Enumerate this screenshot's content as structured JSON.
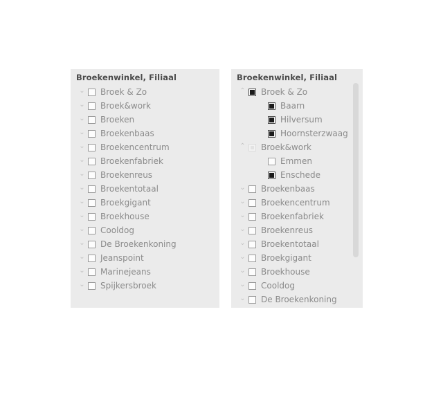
{
  "panels": {
    "collapsed": {
      "header": "Broekenwinkel, Filiaal",
      "nodes": [
        {
          "label": "Broek & Zo",
          "level": 0,
          "chevron": "v",
          "check": "unchecked"
        },
        {
          "label": "Broek&work",
          "level": 0,
          "chevron": "v",
          "check": "unchecked"
        },
        {
          "label": "Broeken",
          "level": 0,
          "chevron": "v",
          "check": "unchecked"
        },
        {
          "label": "Broekenbaas",
          "level": 0,
          "chevron": "v",
          "check": "unchecked"
        },
        {
          "label": "Broekencentrum",
          "level": 0,
          "chevron": "v",
          "check": "unchecked"
        },
        {
          "label": "Broekenfabriek",
          "level": 0,
          "chevron": "v",
          "check": "unchecked"
        },
        {
          "label": "Broekenreus",
          "level": 0,
          "chevron": "v",
          "check": "unchecked"
        },
        {
          "label": "Broekentotaal",
          "level": 0,
          "chevron": "v",
          "check": "unchecked"
        },
        {
          "label": "Broekgigant",
          "level": 0,
          "chevron": "v",
          "check": "unchecked"
        },
        {
          "label": "Broekhouse",
          "level": 0,
          "chevron": "v",
          "check": "unchecked"
        },
        {
          "label": "Cooldog",
          "level": 0,
          "chevron": "v",
          "check": "unchecked"
        },
        {
          "label": "De Broekenkoning",
          "level": 0,
          "chevron": "v",
          "check": "unchecked"
        },
        {
          "label": "Jeanspoint",
          "level": 0,
          "chevron": "v",
          "check": "unchecked"
        },
        {
          "label": "Marinejeans",
          "level": 0,
          "chevron": "v",
          "check": "unchecked"
        },
        {
          "label": "Spijkersbroek",
          "level": 0,
          "chevron": "v",
          "check": "unchecked"
        }
      ]
    },
    "expanded": {
      "header": "Broekenwinkel, Filiaal",
      "nodes": [
        {
          "label": "Broek & Zo",
          "level": 0,
          "chevron": "^",
          "check": "checked"
        },
        {
          "label": "Baarn",
          "level": 1,
          "chevron": "",
          "check": "checked"
        },
        {
          "label": "Hilversum",
          "level": 1,
          "chevron": "",
          "check": "checked"
        },
        {
          "label": "Hoornsterzwaag",
          "level": 1,
          "chevron": "",
          "check": "checked"
        },
        {
          "label": "Broek&work",
          "level": 0,
          "chevron": "^",
          "check": "partial"
        },
        {
          "label": "Emmen",
          "level": 1,
          "chevron": "",
          "check": "unchecked"
        },
        {
          "label": "Enschede",
          "level": 1,
          "chevron": "",
          "check": "checked"
        },
        {
          "label": "Broekenbaas",
          "level": 0,
          "chevron": "v",
          "check": "unchecked"
        },
        {
          "label": "Broekencentrum",
          "level": 0,
          "chevron": "v",
          "check": "unchecked"
        },
        {
          "label": "Broekenfabriek",
          "level": 0,
          "chevron": "v",
          "check": "unchecked"
        },
        {
          "label": "Broekenreus",
          "level": 0,
          "chevron": "v",
          "check": "unchecked"
        },
        {
          "label": "Broekentotaal",
          "level": 0,
          "chevron": "v",
          "check": "unchecked"
        },
        {
          "label": "Broekgigant",
          "level": 0,
          "chevron": "v",
          "check": "unchecked"
        },
        {
          "label": "Broekhouse",
          "level": 0,
          "chevron": "v",
          "check": "unchecked"
        },
        {
          "label": "Cooldog",
          "level": 0,
          "chevron": "v",
          "check": "unchecked"
        },
        {
          "label": "De Broekenkoning",
          "level": 0,
          "chevron": "v",
          "check": "unchecked"
        }
      ],
      "scrollbar": {
        "visible": true
      }
    }
  },
  "colors": {
    "panel_background": "#ebebeb",
    "page_background": "#ffffff",
    "label_text": "#8b8b8b",
    "header_text": "#4a4a4a",
    "checkbox_fill": "#1a1a1a",
    "chevron": "#c2c2c2",
    "scrollbar_thumb": "#d8d8d8"
  }
}
